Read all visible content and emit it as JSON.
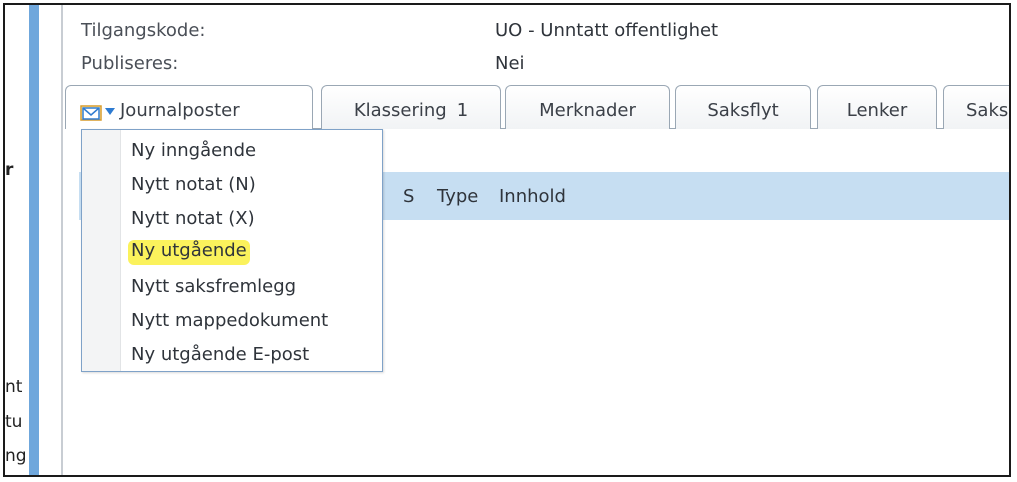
{
  "metadata": {
    "access_code_label": "Tilgangskode:",
    "access_code_value": "UO - Unntatt offentlighet",
    "publish_label": "Publiseres:",
    "publish_value": "Nei"
  },
  "left_fragments": [
    "r",
    "nt",
    "tu",
    "ng"
  ],
  "tabs": [
    {
      "label": "Journalposter",
      "icon": "mail-folder-icon"
    },
    {
      "label": "Klassering",
      "count": "1"
    },
    {
      "label": "Merknader"
    },
    {
      "label": "Saksflyt"
    },
    {
      "label": "Lenker"
    },
    {
      "label": "Saks"
    }
  ],
  "grid": {
    "columns": [
      "S",
      "Type",
      "Innhold"
    ]
  },
  "dropdown": {
    "items": [
      {
        "label": "Ny inngående"
      },
      {
        "label": "Nytt notat (N)"
      },
      {
        "label": "Nytt notat (X)"
      },
      {
        "label": "Ny utgående",
        "highlighted": true
      },
      {
        "label": "Nytt saksfremlegg"
      },
      {
        "label": "Nytt mappedokument"
      },
      {
        "label": "Ny utgående E-post"
      }
    ]
  },
  "colors": {
    "highlight": "#fbf25c",
    "header_bar": "#c6def2",
    "accent": "#2e7bd1",
    "left_bar": "#6fa7dc"
  }
}
